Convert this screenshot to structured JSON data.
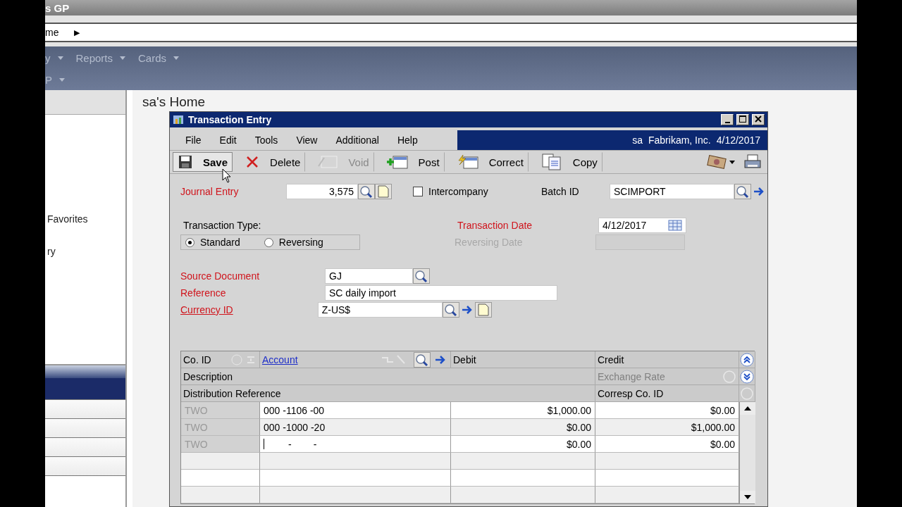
{
  "app": {
    "title": "s GP",
    "breadcrumb": "me",
    "breadcrumb_arrow": "▶",
    "nav_menus": [
      {
        "label": "y"
      },
      {
        "label": "Reports"
      },
      {
        "label": "Cards"
      }
    ],
    "nav_menus_row2": [
      {
        "label": "P"
      }
    ],
    "sidebar": {
      "items": [
        "Favorites",
        "ry"
      ],
      "nav_buttons": [
        {
          "selected": true
        },
        {
          "selected": false
        },
        {
          "selected": false
        },
        {
          "selected": false
        },
        {
          "selected": false
        }
      ]
    },
    "page_title": "sa's Home"
  },
  "dialog": {
    "title": "Transaction Entry",
    "menu": [
      "File",
      "Edit",
      "Tools",
      "View",
      "Additional",
      "Help"
    ],
    "user": "sa",
    "company": "Fabrikam, Inc.",
    "date": "4/12/2017",
    "toolbar": [
      {
        "kind": "save",
        "label": "Save",
        "hover": true,
        "disabled": false
      },
      {
        "kind": "delete",
        "label": "Delete",
        "hover": false,
        "disabled": false
      },
      {
        "kind": "void",
        "label": "Void",
        "hover": false,
        "disabled": true
      },
      {
        "kind": "post",
        "label": "Post",
        "hover": false,
        "disabled": false
      },
      {
        "kind": "correct",
        "label": "Correct",
        "hover": false,
        "disabled": false
      },
      {
        "kind": "copy",
        "label": "Copy",
        "hover": false,
        "disabled": false
      }
    ],
    "journal_entry": {
      "label": "Journal Entry",
      "value": "3,575",
      "required": true
    },
    "intercompany": {
      "label": "Intercompany",
      "checked": false
    },
    "batch_id": {
      "label": "Batch ID",
      "value": "SCIMPORT",
      "required": false
    },
    "transaction_type": {
      "label": "Transaction Type:",
      "options": [
        {
          "label": "Standard",
          "selected": true
        },
        {
          "label": "Reversing",
          "selected": false
        }
      ]
    },
    "transaction_date": {
      "label": "Transaction Date",
      "value": "4/12/2017",
      "required": true
    },
    "reversing_date": {
      "label": "Reversing Date",
      "disabled": true
    },
    "source_document": {
      "label": "Source Document",
      "value": "GJ",
      "required": true
    },
    "reference": {
      "label": "Reference",
      "value": "SC daily import",
      "required": true
    },
    "currency_id": {
      "label": "Currency ID",
      "value": "Z-US$",
      "required": true
    },
    "grid": {
      "headers": {
        "co_id": "Co. ID",
        "account": "Account",
        "debit": "Debit",
        "credit": "Credit",
        "description": "Description",
        "exchange_rate": "Exchange Rate",
        "distribution_reference": "Distribution Reference",
        "corresp_co_id": "Corresp Co. ID"
      },
      "rows": [
        {
          "co": "TWO",
          "account": "000 -1106 -00",
          "debit": "$1,000.00",
          "credit": "$0.00",
          "editing": false
        },
        {
          "co": "TWO",
          "account": "000 -1000 -20",
          "debit": "$0.00",
          "credit": "$1,000.00",
          "editing": false
        },
        {
          "co": "TWO",
          "account": "-        -",
          "debit": "$0.00",
          "credit": "$0.00",
          "editing": true
        }
      ]
    }
  }
}
